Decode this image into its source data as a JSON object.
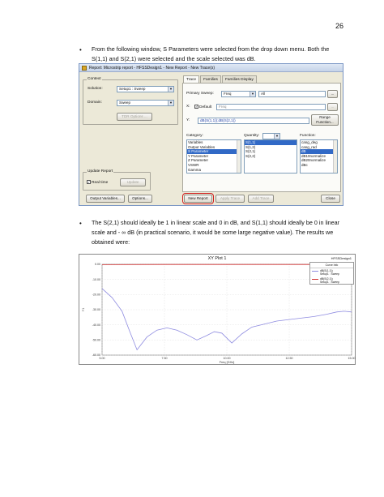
{
  "page_number": "26",
  "bullet1": {
    "line1": "From the following window, S Parameters were selected from the drop down menu. Both the",
    "line2": "S(1,1) and S(2,1) were selected and the scale selected was dB."
  },
  "dialog": {
    "title": "Report: Microstrip report - HFSSDesign1 - New Report - New Trace(s)",
    "context": {
      "group_label": "Context",
      "solution_label": "Solution:",
      "solution_value": "Setup1 : Sweep",
      "domain_label": "Domain:",
      "domain_value": "Sweep",
      "tdr_options": "TDR Options ..."
    },
    "tabs": [
      "Trace",
      "Families",
      "Families Display"
    ],
    "primary_sweep_label": "Primary Sweep:",
    "primary_sweep_value": "Freq",
    "primary_sweep_all": "All",
    "ellipsis": "...",
    "x_label": "X:",
    "default_label": "Default",
    "x_value": "Freq",
    "y_label": "Y:",
    "y_value": "dB(S(1,1));dB(S(2,1))",
    "range_function": "Range Function...",
    "category_label": "Category:",
    "categories": [
      "Variables",
      "Output Variables",
      "S Parameter",
      "Y Parameter",
      "Z Parameter",
      "VSWR",
      "Gamma"
    ],
    "category_selected": "S Parameter",
    "quantity_label": "Quantity:",
    "quantities": [
      "S(1,1)",
      "S(1,2)",
      "S(2,1)",
      "S(2,2)"
    ],
    "quantity_selected": [
      "S(1,1)"
    ],
    "function_label": "Function:",
    "functions": [
      "cang_deg",
      "cang_rad",
      "dB",
      "dB10normalize",
      "dB20normalize",
      "dBc"
    ],
    "function_selected": "dB",
    "update_report": {
      "group_label": "Update Report",
      "realtime_label": "Real time",
      "update_button": "Update"
    },
    "buttons": {
      "output_variables": "Output Variables...",
      "options": "Options...",
      "new_report": "New Report",
      "apply_trace": "Apply Trace",
      "add_trace": "Add Trace",
      "close": "Close"
    }
  },
  "bullet2": {
    "line1": "The S(2,1) should ideally be 1 in linear scale and 0 in dB, and S(1,1) should ideally be 0 in linear",
    "line2": "scale and - ∞  dB (in practical scenario, it would be some large negative value). The results we",
    "line3": "obtained were:"
  },
  "chart_data": {
    "type": "line",
    "title": "XY Plot 1",
    "source_label": "HFSSDesign1",
    "xlabel": "Freq [GHz]",
    "ylabel": "Y1",
    "xlim": [
      5.0,
      15.0
    ],
    "ylim": [
      -60.0,
      0.0
    ],
    "x_ticks": [
      "5.00",
      "7.50",
      "10.00",
      "12.50",
      "15.00"
    ],
    "y_ticks": [
      "0.00",
      "-10.00",
      "-20.00",
      "-30.00",
      "-40.00",
      "-50.00",
      "-60.00"
    ],
    "legend_title": "Curve Info",
    "series": [
      {
        "name": "dB(S(1,1))",
        "sub": "Setup1 : Sweep",
        "color": "#8e8be0",
        "x": [
          5.0,
          5.4,
          5.8,
          6.1,
          6.4,
          6.8,
          7.2,
          7.6,
          8.0,
          8.4,
          8.8,
          9.2,
          9.5,
          9.8,
          10.2,
          10.6,
          11.0,
          11.5,
          12.0,
          12.5,
          13.0,
          13.5,
          14.0,
          14.4,
          14.7,
          15.0
        ],
        "y": [
          -16.0,
          -22.0,
          -31.0,
          -44.0,
          -56.5,
          -48.0,
          -43.5,
          -42.0,
          -43.5,
          -46.5,
          -50.0,
          -47.0,
          -44.5,
          -45.5,
          -52.0,
          -46.0,
          -41.5,
          -39.5,
          -37.5,
          -36.5,
          -35.5,
          -34.5,
          -33.0,
          -31.5,
          -31.0,
          -31.5
        ]
      },
      {
        "name": "dB(S(2,1))",
        "sub": "Setup1 : Sweep",
        "color": "#d03030",
        "x": [
          5.0,
          7.5,
          10.0,
          12.5,
          15.0
        ],
        "y": [
          -0.2,
          -0.1,
          -0.1,
          -0.1,
          -0.1
        ]
      }
    ],
    "legend_placement": "top-right",
    "grid": true
  }
}
